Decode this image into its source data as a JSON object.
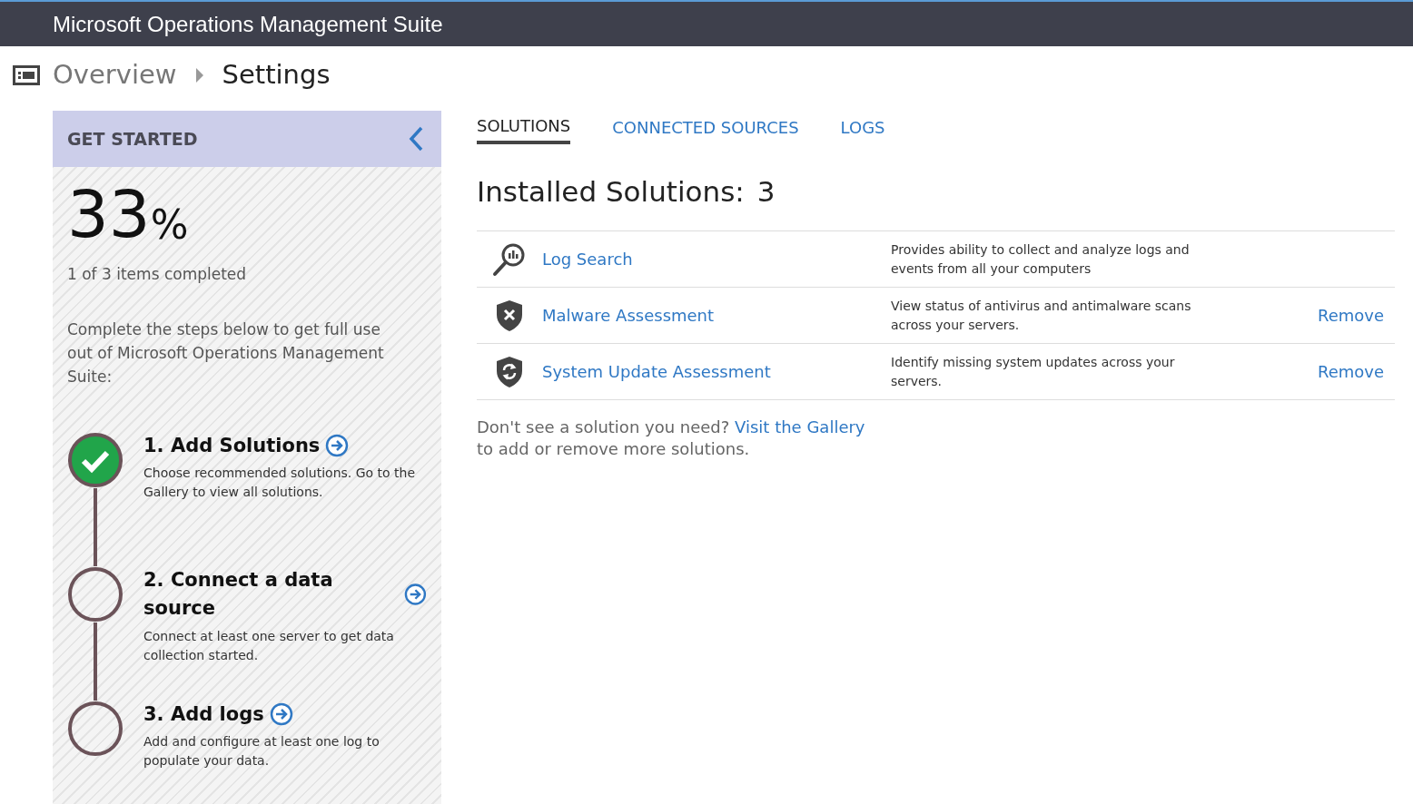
{
  "app_bar": {
    "title": "Microsoft Operations Management Suite"
  },
  "breadcrumb": {
    "parent": "Overview",
    "current": "Settings"
  },
  "get_started": {
    "title": "GET STARTED",
    "percent": "33",
    "percent_sign": "%",
    "progress_text": "1 of 3 items completed",
    "intro": "Complete the steps below to get full use out of Microsoft Operations Management Suite:",
    "steps": [
      {
        "title": "1. Add Solutions",
        "description": "Choose recommended solutions. Go to the Gallery to view all solutions.",
        "completed": true
      },
      {
        "title": "2. Connect a data source",
        "description": "Connect at least one server to get data collection started.",
        "completed": false
      },
      {
        "title": "3. Add logs",
        "description": "Add and configure at least one log to populate your data.",
        "completed": false
      }
    ]
  },
  "tabs": [
    {
      "label": "SOLUTIONS",
      "selected": true
    },
    {
      "label": "CONNECTED SOURCES",
      "selected": false
    },
    {
      "label": "LOGS",
      "selected": false
    }
  ],
  "installed": {
    "label": "Installed Solutions:",
    "count": "3"
  },
  "solutions": [
    {
      "kind": "search",
      "name": "Log Search",
      "description": "Provides ability to collect and analyze logs and events from all your computers"
    },
    {
      "kind": "malware",
      "name": "Malware Assessment",
      "description": "View status of antivirus and antimalware scans across your servers.",
      "action": "Remove"
    },
    {
      "kind": "update",
      "name": "System Update Assessment",
      "description": "Identify missing system updates across your servers.",
      "action": "Remove"
    }
  ],
  "gallery_note": {
    "before": "Don't see a solution you need?",
    "link": "Visit the Gallery",
    "after": "to add or remove more solutions."
  }
}
